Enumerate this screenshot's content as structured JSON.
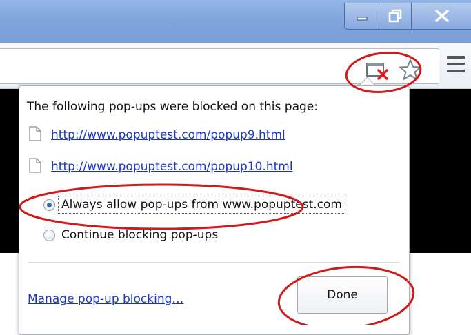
{
  "window": {
    "minimize_icon": "minimize-icon",
    "maximize_icon": "restore-icon",
    "close_icon": "close-icon"
  },
  "toolbar": {
    "popup_blocked_icon": "popup-blocked-icon",
    "bookmark_star_icon": "star-icon",
    "menu_icon": "menu-icon"
  },
  "bubble": {
    "heading": "The following pop-ups were blocked on this page:",
    "blocked_links": [
      "http://www.popuptest.com/popup9.html",
      "http://www.popuptest.com/popup10.html"
    ],
    "options": [
      {
        "label": "Always allow pop-ups from www.popuptest.com",
        "checked": true
      },
      {
        "label": "Continue blocking pop-ups",
        "checked": false
      }
    ],
    "manage_link": "Manage pop-up blocking…",
    "done_label": "Done"
  },
  "colors": {
    "link": "#1a36c8",
    "titlebar": "#7ea2db",
    "annotation": "#d11a1a"
  }
}
